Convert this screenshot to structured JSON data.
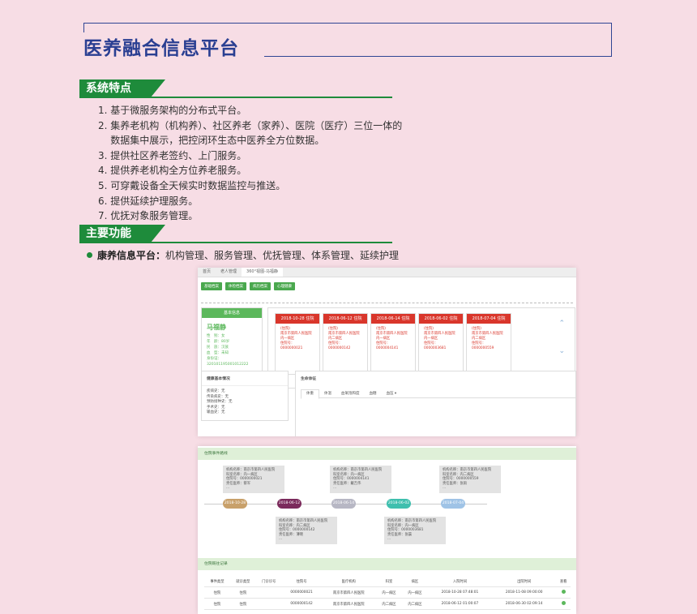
{
  "page": {
    "title": "医养融合信息平台"
  },
  "section1": {
    "tag": "系统特点",
    "items": [
      "1. 基于微服务架构的分布式平台。",
      "2. 集养老机构（机构养）、社区养老（家养）、医院（医疗）三位一体的",
      "    数据集中展示，把控闭环生态中医养全方位数据。",
      "3. 提供社区养老签约、上门服务。",
      "4. 提供养老机构全方位养老服务。",
      "5. 可穿戴设备全天候实时数据监控与推送。",
      "6. 提供延续护理服务。",
      "7. 优抚对象服务管理。"
    ]
  },
  "section2": {
    "tag": "主要功能",
    "bullet_label": "康养信息平台：",
    "bullet_text": "机构管理、服务管理、优抚管理、体系管理、延续护理"
  },
  "shot1": {
    "tabs": [
      "首页",
      "老人管理",
      "360°视图-马福静"
    ],
    "buttons": [
      "基础档案",
      "体检档案",
      "病历档案",
      "心理健康"
    ],
    "profile": {
      "header": "基本信息",
      "name": "马福静",
      "lines": [
        "性　别：女",
        "年　龄：80岁",
        "民　族：汉族",
        "血　型：未知",
        "身份证：",
        "320101195001012222"
      ]
    },
    "cards": [
      {
        "date": "2018-10-28 住院",
        "lines": [
          "(住院)",
          "南京市第四人民医院",
          "内一病区",
          "住院号：",
          "0000000021"
        ]
      },
      {
        "date": "2018-06-12 住院",
        "lines": [
          "(住院)",
          "南京市第四人民医院",
          "内二病区",
          "住院号：",
          "0000000142"
        ]
      },
      {
        "date": "2018-06-14 住院",
        "lines": [
          "(住院)",
          "南京市第四人民医院",
          "内一病区",
          "住院号：",
          "0000004141"
        ]
      },
      {
        "date": "2018-06-02 住院",
        "lines": [
          "(住院)",
          "南京市第四人民医院",
          "内一病区",
          "住院号：",
          "0000003681"
        ]
      },
      {
        "date": "2018-07-04 住院",
        "lines": [
          "(住院)",
          "南京市第四人民医院",
          "内二病区",
          "住院号：",
          "0000000559"
        ]
      }
    ],
    "basic": {
      "title": "健康基本情况",
      "lines": [
        "疾病史：无",
        "传染病史：无",
        "预防接种史：无",
        "手术史：无",
        "输血史：无"
      ]
    },
    "vital": {
      "title": "生命体征",
      "tabs": [
        "体重",
        "体温",
        "血氧饱和度",
        "血糖",
        "血压 ▾"
      ]
    }
  },
  "shot2": {
    "timeline_title": "住院事件路线",
    "pills": [
      {
        "label": "2018-10-28",
        "color": "#c8a06a"
      },
      {
        "label": "2018-06-12",
        "color": "#7b2a5c"
      },
      {
        "label": "2018-06-14",
        "color": "#b7b7c4"
      },
      {
        "label": "2018-06-02",
        "color": "#3fbfae"
      },
      {
        "label": "2018-07-04",
        "color": "#9fc3e6"
      }
    ],
    "bubbles_top": [
      [
        "机构名称：南京市第四人民医院",
        "科室名称：内一病区",
        "住院号：0000000021",
        "责任医师：蔡军",
        "..."
      ],
      [
        "机构名称：南京市第四人民医院",
        "科室名称：内一病区",
        "住院号：0000004141",
        "责任医师：戴吉伟",
        "..."
      ],
      [
        "机构名称：南京市第四人民医院",
        "科室名称：内二病区",
        "住院号：0000000559",
        "责任医师：张雨",
        "..."
      ]
    ],
    "bubbles_bottom": [
      [
        "机构名称：南京市第四人民医院",
        "科室名称：内二病区",
        "住院号：0000000142",
        "责任医师：薄晓",
        "..."
      ],
      [
        "机构名称：南京市第四人民医院",
        "科室名称：内一病区",
        "住院号：0000003681",
        "责任医师：张晨",
        "..."
      ]
    ],
    "record_title": "住院既往记录",
    "table": {
      "headers": [
        "事件类型",
        "就诊类型",
        "门诊诊号",
        "住院号",
        "医疗机构",
        "科室",
        "病区",
        "入院时间",
        "出院时间",
        "查看"
      ],
      "rows": [
        [
          "住院",
          "住院",
          "",
          "0000000021",
          "南京市第四人民医院",
          "内一病区",
          "内一病区",
          "2018-10-28 07:48:01",
          "2018-11-08 09:00:00",
          ""
        ],
        [
          "住院",
          "住院",
          "",
          "0000000142",
          "南京市第四人民医院",
          "内二病区",
          "内二病区",
          "2018-06-12 01:00:07",
          "2018-06-30 02:09:14",
          ""
        ]
      ]
    }
  }
}
